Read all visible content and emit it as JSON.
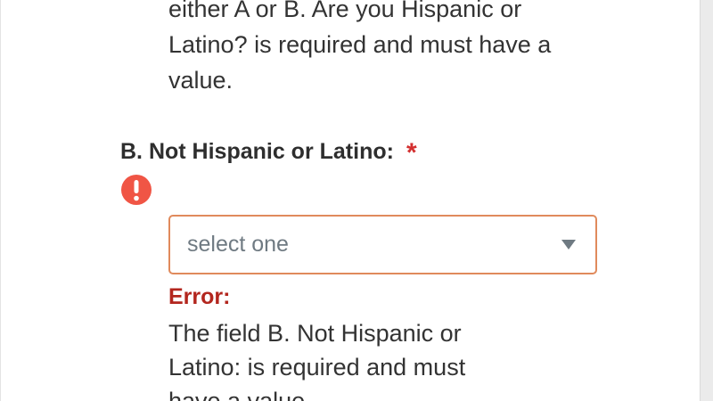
{
  "previous_field": {
    "error_message": "either A or B. Are you Hispanic or Latino? is required and must have a value."
  },
  "field": {
    "label": "B. Not Hispanic or Latino:",
    "required_marker": "*",
    "select": {
      "value": "select one"
    },
    "error": {
      "heading": "Error:",
      "message": "The field B. Not Hispanic or Latino: is required and must have a value."
    }
  },
  "icons": {
    "error": "exclamation-circle-icon",
    "dropdown": "chevron-down-icon"
  },
  "colors": {
    "required": "#d32f2f",
    "error_icon": "#f05545",
    "error_heading": "#b3261e",
    "select_border": "#e08a5c"
  }
}
